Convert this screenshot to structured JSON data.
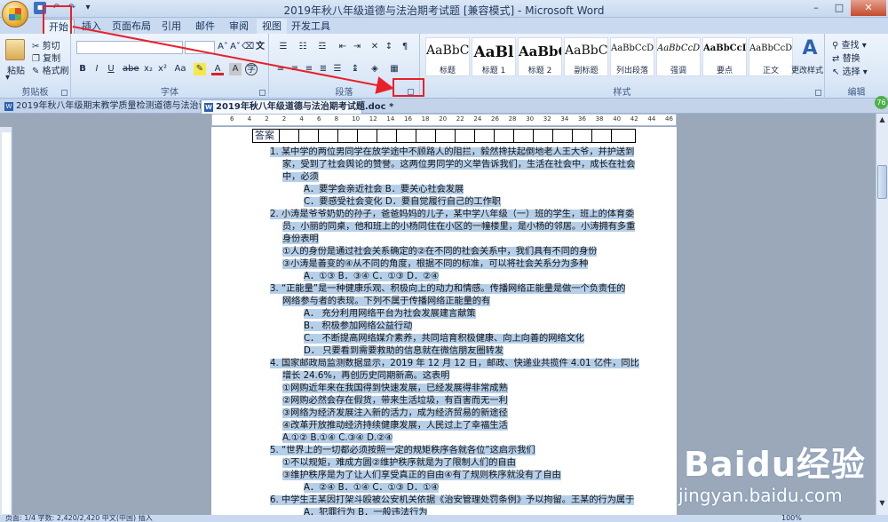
{
  "window": {
    "title": "2019年秋八年级道德与法治期考试题 [兼容模式] - Microsoft Word",
    "controls": {
      "minimize": "–",
      "maximize": "□",
      "close": "✕"
    }
  },
  "tabs": [
    "开始",
    "插入",
    "页面布局",
    "引用",
    "邮件",
    "审阅",
    "视图",
    "开发工具"
  ],
  "ribbon": {
    "clipboard": {
      "paste": "粘贴",
      "cut": "剪切",
      "copy": "复制",
      "format_painter": "格式刷",
      "label": "剪贴板"
    },
    "font": {
      "label": "字体",
      "bold": "B",
      "italic": "I",
      "underline": "U",
      "strike": "abe",
      "sub": "x₂",
      "sup": "x²",
      "aa": "Aa",
      "grow": "A˄",
      "shrink": "A˅",
      "color_a": "A",
      "char_a": "A"
    },
    "paragraph": {
      "label": "段落"
    },
    "styles": {
      "label": "样式",
      "items": [
        {
          "sample": "AaBbC",
          "name": "标题"
        },
        {
          "sample": "AaBl",
          "name": "标题 1"
        },
        {
          "sample": "AaBbC",
          "name": "标题 2"
        },
        {
          "sample": "AaBbC",
          "name": "副标题"
        },
        {
          "sample": "AaBbCcDd",
          "name": "列出段落"
        },
        {
          "sample": "AaBbCcD",
          "name": "强调"
        },
        {
          "sample": "AaBbCcD",
          "name": "要点"
        },
        {
          "sample": "AaBbCcDc",
          "name": "正文"
        }
      ],
      "change_styles": "更改样式"
    },
    "editing": {
      "label": "编辑",
      "find": "查找",
      "replace": "替换",
      "select": "选择"
    }
  },
  "doc_tabs": [
    {
      "label": "2019年秋八年级期末教学质量检测道德与法治试题.doc",
      "active": false
    },
    {
      "label": "2019年秋八年级道德与法治期考试题.doc *",
      "active": true
    }
  ],
  "ruler_numbers": [
    "6",
    "4",
    "2",
    "2",
    "4",
    "6",
    "8",
    "10",
    "12",
    "14",
    "16",
    "18",
    "20",
    "22",
    "24",
    "26",
    "28",
    "30",
    "32",
    "34",
    "36",
    "38",
    "40",
    "42",
    "44",
    "46"
  ],
  "document": {
    "table_header": "答案",
    "lines": [
      "1. 某中学的两位男同学在放学途中不顾路人的阻拦，毅然搀扶起倒地老人王大爷，并护送到",
      "家，受到了社会舆论的赞誉。这两位男同学的义举告诉我们，生活在社会中，成长在社会",
      "中，必须",
      "A．要学会亲近社会   B．要关心社会发展",
      "C．要感受社会变化   D．要自觉履行自己的工作职",
      "2. 小涛是爷爷奶奶的孙子，爸爸妈妈的儿子，某中学八年级（一）班的学生，班上的体育委",
      "员，小丽的同桌，他和班上的小杨同住在小区的一幢楼里，是小杨的邻居。小涛拥有多重",
      "身份表明",
      "①人的身份是通过社会关系确定的②在不同的社会关系中，我们具有不同的身份",
      "③小涛是善变的④从不同的角度，根据不同的标准，可以将社会关系分为多种",
      "A．①③  B．③④  C．①③  D．②④",
      "3. “正能量”是一种健康乐观、积极向上的动力和情感。传播网络正能量是做一个负责任的",
      "网络参与者的表现。下列不属于传播网络正能量的有",
      "A． 充分利用网络平台为社会发展建言献策",
      "B． 积极参加网络公益行动",
      "C． 不断提高网络媒介素养，共同培育积极健康、向上向善的网络文化",
      "D． 只要看到需要救助的信息就在微信朋友圈转发",
      "4. 国家邮政局监测数据显示，2019 年 12 月 12 日，邮政、快递业共揽件 4.01 亿件，同比",
      "增长 24.6%，再创历史同期新高。这表明",
      "①网购近年来在我国得到快速发展，已经发展得非常成熟",
      "②网购必然会存在假货，带来生活垃圾，有百害而无一利",
      "③网络为经济发展注入新的活力，成为经济贸易的新途径",
      "④改革开放推动经济持续健康发展，人民过上了幸福生活",
      "A.①②  B.①④  C.③④  D.②④",
      "5. “世界上的一切都必须按照一定的规矩秩序各就各位”这启示我们",
      "①不以规矩，难成方圆②维护秩序就是为了限制人们的自由",
      "③维护秩序是为了让人们享受真正的自由④有了规则秩序就没有了自由",
      "A．②④   B．①④   C．①③   D．①④",
      "6. 中学生王某因打架斗殴被公安机关依据《治安管理处罚条例》予以拘留。王某的行为属于",
      "A．犯罪行为   B．一般违法行为"
    ]
  },
  "status": {
    "text": "页面: 1/4   字数: 2,420/2,420   中文(中国)   插入",
    "zoom": "100%"
  },
  "watermark": {
    "brand": "Baidu经验",
    "url": "jingyan.baidu.com"
  },
  "badge": "76",
  "colors": {
    "highlight": "#b6cfe9",
    "annotation": "#e8202a",
    "ribbon": "#dce8f7"
  }
}
